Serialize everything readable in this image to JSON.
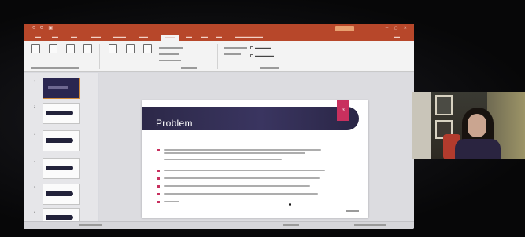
{
  "window": {
    "quick_access": "⟲ ⟳ ▣",
    "doc_title": "",
    "signin": "",
    "controls": "─ ▢ ✕"
  },
  "ribbon_tabs": [
    "",
    "",
    "",
    "",
    "",
    "",
    "",
    "",
    "",
    ""
  ],
  "active_tab_index": 6,
  "slide": {
    "title": "Problem",
    "number": "3"
  },
  "thumbnails": [
    {
      "num": "1",
      "type": "title"
    },
    {
      "num": "2",
      "type": "content"
    },
    {
      "num": "3",
      "type": "content"
    },
    {
      "num": "4",
      "type": "content"
    },
    {
      "num": "5",
      "type": "content"
    },
    {
      "num": "6",
      "type": "content"
    }
  ],
  "colors": {
    "ribbon_accent": "#b7472a",
    "slide_band": "#2c2848",
    "bullet_accent": "#c8305e"
  }
}
